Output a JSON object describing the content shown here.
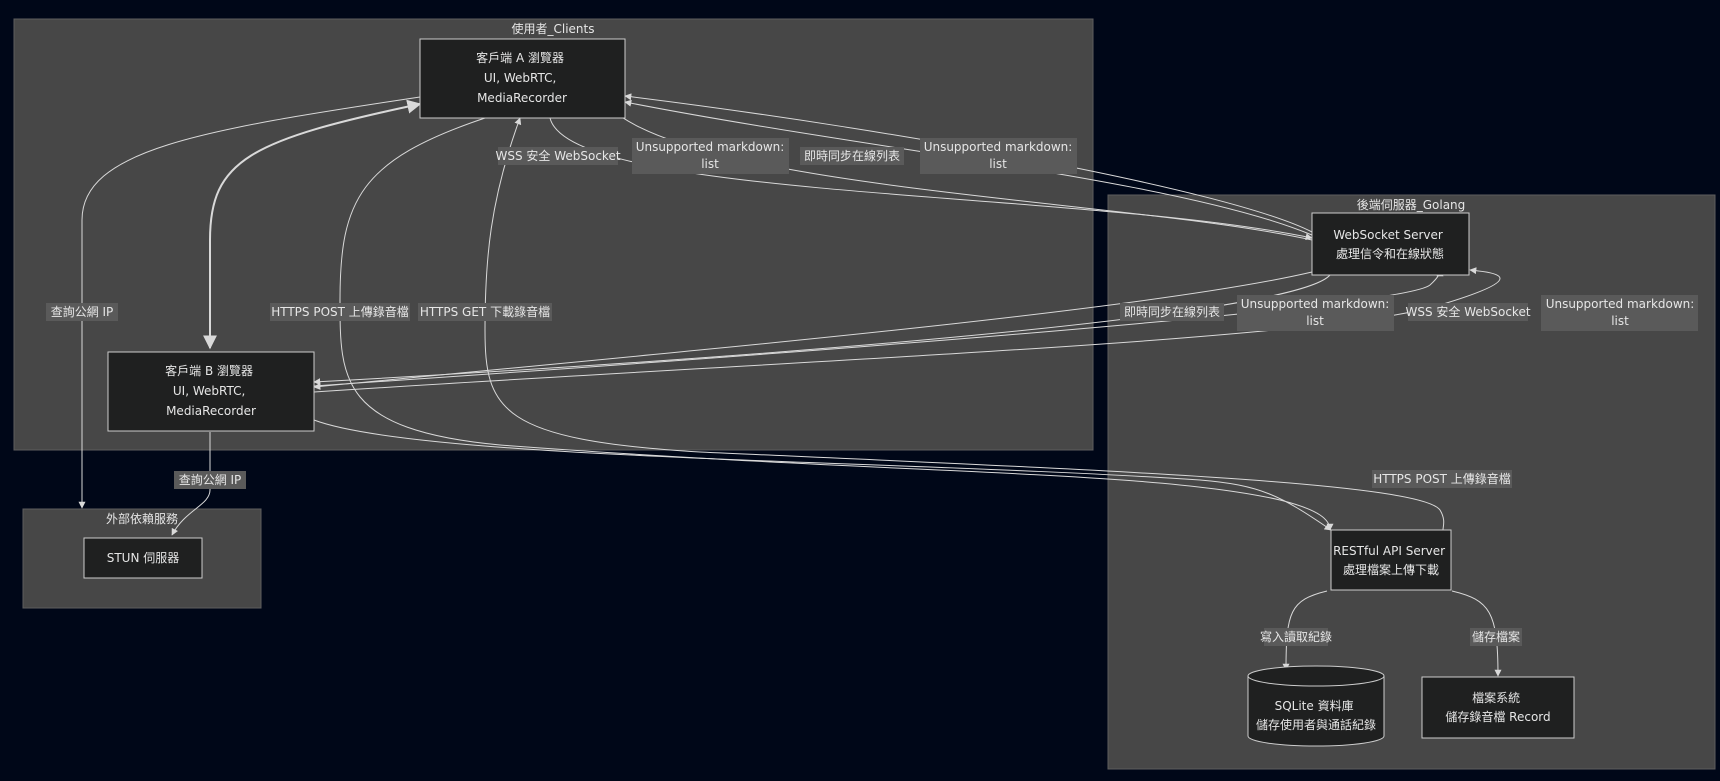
{
  "colors": {
    "background": "#000718",
    "cluster_fill": "#474747",
    "cluster_stroke": "#5e5e5e",
    "node_fill": "#1f2020",
    "node_stroke": "#cccccc",
    "edge": "#d9d9d9",
    "edge_label_bg": "#5a5a5a",
    "text": "#e6e6e6"
  },
  "clusters": {
    "clients": {
      "title": "使用者_Clients"
    },
    "backend": {
      "title": "後端伺服器_Golang"
    },
    "external": {
      "title": "外部依賴服務"
    }
  },
  "nodes": {
    "client_a": {
      "lines": [
        "客戶端 A 瀏覽器",
        "UI, WebRTC,",
        "MediaRecorder"
      ]
    },
    "client_b": {
      "lines": [
        "客戶端 B 瀏覽器",
        "UI, WebRTC,",
        "MediaRecorder"
      ]
    },
    "websocket_server": {
      "lines": [
        "WebSocket Server",
        "處理信令和在線狀態"
      ]
    },
    "restful_api_server": {
      "lines": [
        "RESTful API Server",
        "處理檔案上傳下載"
      ]
    },
    "sqlite_db": {
      "lines": [
        "SQLite 資料庫",
        "儲存使用者與通話紀錄"
      ]
    },
    "file_system": {
      "lines": [
        "檔案系統",
        "儲存錄音檔 Record"
      ]
    },
    "stun_server": {
      "lines": [
        "STUN 伺服器"
      ]
    }
  },
  "edge_labels": {
    "a_query_ip": "查詢公網 IP",
    "a_https_post": "HTTPS POST 上傳錄音檔",
    "a_https_get": "HTTPS GET 下載錄音檔",
    "a_wss": "WSS 安全 WebSocket",
    "a_unsupported_1": "Unsupported markdown:\nlist",
    "a_realtime_list": "即時同步在線列表",
    "a_unsupported_2": "Unsupported markdown:\nlist",
    "b_realtime_list": "即時同步在線列表",
    "b_unsupported_1": "Unsupported markdown:\nlist",
    "b_wss": "WSS 安全 WebSocket",
    "b_unsupported_2": "Unsupported markdown:\nlist",
    "b_query_ip": "查詢公網 IP",
    "b_https_post": "HTTPS POST 上傳錄音檔",
    "db_rw": "寫入讀取紀錄",
    "fs_store": "儲存檔案"
  }
}
